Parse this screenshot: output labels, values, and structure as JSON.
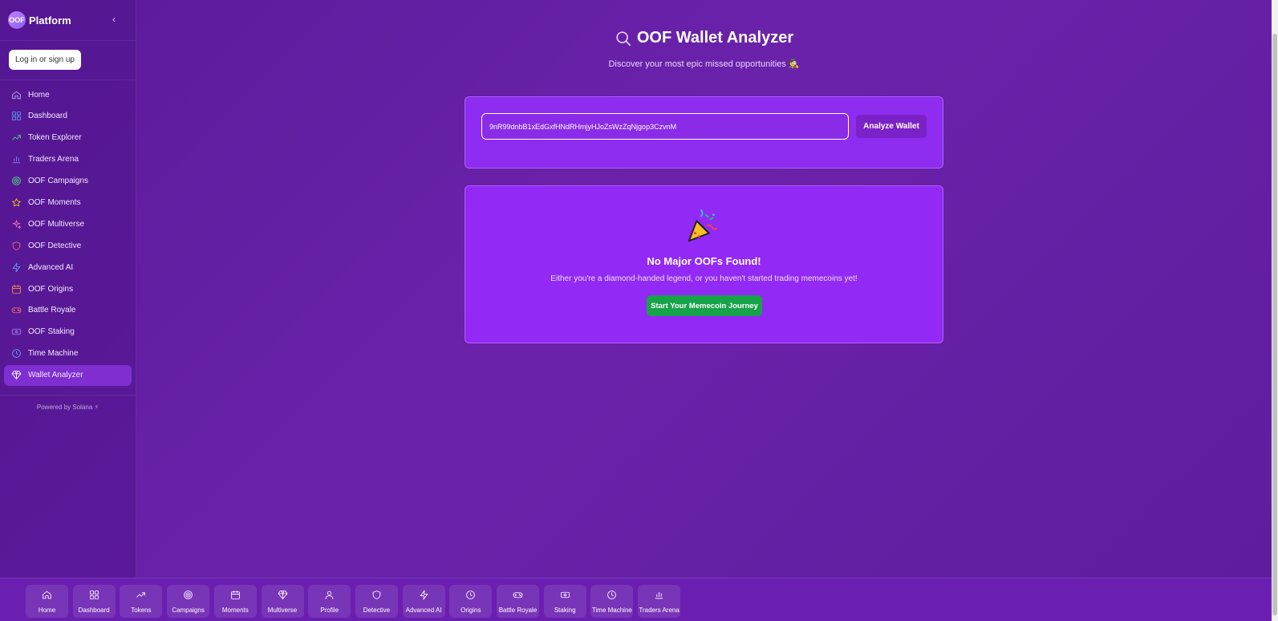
{
  "brand": {
    "logo": "OOF",
    "name": "Platform"
  },
  "auth": {
    "label": "Log in or sign up"
  },
  "sidebar": {
    "items": [
      {
        "label": "Home",
        "icon": "home-icon",
        "color": "#c4b5fd"
      },
      {
        "label": "Dashboard",
        "icon": "dashboard-icon",
        "color": "#60a5fa"
      },
      {
        "label": "Token Explorer",
        "icon": "trending-up-icon",
        "color": "#4ade80"
      },
      {
        "label": "Traders Arena",
        "icon": "bar-chart-icon",
        "color": "#818cf8"
      },
      {
        "label": "OOF Campaigns",
        "icon": "target-icon",
        "color": "#4ade80"
      },
      {
        "label": "OOF Moments",
        "icon": "star-icon",
        "color": "#facc15"
      },
      {
        "label": "OOF Multiverse",
        "icon": "sparkles-icon",
        "color": "#f472b6"
      },
      {
        "label": "OOF Detective",
        "icon": "shield-icon",
        "color": "#f87171"
      },
      {
        "label": "Advanced AI",
        "icon": "zap-icon",
        "color": "#60a5fa"
      },
      {
        "label": "OOF Origins",
        "icon": "calendar-icon",
        "color": "#fb923c"
      },
      {
        "label": "Battle Royale",
        "icon": "gamepad-icon",
        "color": "#f87171"
      },
      {
        "label": "OOF Staking",
        "icon": "coins-icon",
        "color": "#a78bfa"
      },
      {
        "label": "Time Machine",
        "icon": "clock-icon",
        "color": "#60a5fa"
      },
      {
        "label": "Wallet Analyzer",
        "icon": "gem-icon",
        "color": "#ffffff",
        "active": true
      }
    ],
    "powered": "Powered by Solana ⚡"
  },
  "main": {
    "title": "OOF Wallet Analyzer",
    "subtitle": "Discover your most epic missed opportunities 🕵️",
    "wallet_value": "9nR99dnbB1xEdGxfHNdRHmjyHJoZsWzZqNjgop3CzvnM",
    "analyze_label": "Analyze Wallet",
    "empty_title": "No Major OOFs Found!",
    "empty_desc": "Either you're a diamond-handed legend, or you haven't started trading memecoins yet!",
    "journey_label": "Start Your Memecoin Journey"
  },
  "bottom_nav": [
    {
      "label": "Home",
      "icon": "home-icon"
    },
    {
      "label": "Dashboard",
      "icon": "dashboard-icon"
    },
    {
      "label": "Tokens",
      "icon": "trending-up-icon"
    },
    {
      "label": "Campaigns",
      "icon": "target-icon"
    },
    {
      "label": "Moments",
      "icon": "calendar-icon"
    },
    {
      "label": "Multiverse",
      "icon": "gem-icon"
    },
    {
      "label": "Profile",
      "icon": "user-icon"
    },
    {
      "label": "Detective",
      "icon": "shield-icon"
    },
    {
      "label": "Advanced AI",
      "icon": "zap-icon"
    },
    {
      "label": "Origins",
      "icon": "clock-icon"
    },
    {
      "label": "Battle Royale",
      "icon": "gamepad-icon"
    },
    {
      "label": "Staking",
      "icon": "coins-icon"
    },
    {
      "label": "Time Machine",
      "icon": "clock-icon"
    },
    {
      "label": "Traders Arena",
      "icon": "bar-chart-icon"
    }
  ]
}
